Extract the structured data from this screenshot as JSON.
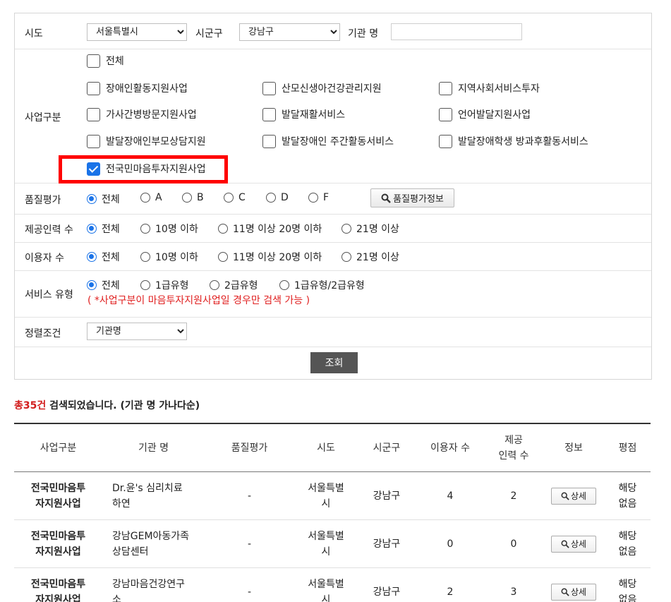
{
  "filters": {
    "sido_label": "시도",
    "sido_value": "서울특별시",
    "sigungu_label": "시군구",
    "sigungu_value": "강남구",
    "org_label": "기관 명",
    "org_value": "",
    "business_label": "사업구분",
    "business_items": [
      {
        "label": "전체",
        "checked": false
      },
      {
        "label": "장애인활동지원사업",
        "checked": false
      },
      {
        "label": "산모신생아건강관리지원",
        "checked": false
      },
      {
        "label": "지역사회서비스투자",
        "checked": false
      },
      {
        "label": "가사간병방문지원사업",
        "checked": false
      },
      {
        "label": "발달재활서비스",
        "checked": false
      },
      {
        "label": "언어발달지원사업",
        "checked": false
      },
      {
        "label": "발달장애인부모상담지원",
        "checked": false
      },
      {
        "label": "발달장애인 주간활동서비스",
        "checked": false
      },
      {
        "label": "발달장애학생 방과후활동서비스",
        "checked": false
      },
      {
        "label": "전국민마음투자지원사업",
        "checked": true
      }
    ],
    "quality_label": "품질평가",
    "quality_options": [
      "전체",
      "A",
      "B",
      "C",
      "D",
      "F"
    ],
    "quality_button": "품질평가정보",
    "staff_label": "제공인력 수",
    "staff_options": [
      "전체",
      "10명 이하",
      "11명 이상 20명 이하",
      "21명 이상"
    ],
    "users_label": "이용자 수",
    "users_options": [
      "전체",
      "10명 이하",
      "11명 이상 20명 이하",
      "21명 이상"
    ],
    "service_label": "서비스 유형",
    "service_options": [
      "전체",
      "1급유형",
      "2급유형",
      "1급유형/2급유형"
    ],
    "service_note": "( *사업구분이 마음투자지원사업일 경우만 검색 가능 )",
    "sort_label": "정렬조건",
    "sort_value": "기관명",
    "search_button": "조회"
  },
  "summary": {
    "count_text": "총35건",
    "rest_text": " 검색되었습니다. (기관 명 가나다순)"
  },
  "table": {
    "headers": [
      "사업구분",
      "기관 명",
      "품질평가",
      "시도",
      "시군구",
      "이용자 수",
      "제공\n인력 수",
      "정보",
      "평점"
    ],
    "detail_label": "상세",
    "rows": [
      {
        "business": "전국민마음투\n자지원사업",
        "org": "Dr.윤's 심리치료\n하연",
        "quality": "-",
        "sido": "서울특별\n시",
        "sigungu": "강남구",
        "users": "4",
        "staff": "2",
        "rating": "해당\n없음"
      },
      {
        "business": "전국민마음투\n자지원사업",
        "org": "강남GEM아동가족\n상담센터",
        "quality": "-",
        "sido": "서울특별\n시",
        "sigungu": "강남구",
        "users": "0",
        "staff": "0",
        "rating": "해당\n없음"
      },
      {
        "business": "전국민마음투\n자지원사업",
        "org": "강남마음건강연구\n소",
        "quality": "-",
        "sido": "서울특별\n시",
        "sigungu": "강남구",
        "users": "2",
        "staff": "3",
        "rating": "해당\n없음"
      }
    ]
  }
}
